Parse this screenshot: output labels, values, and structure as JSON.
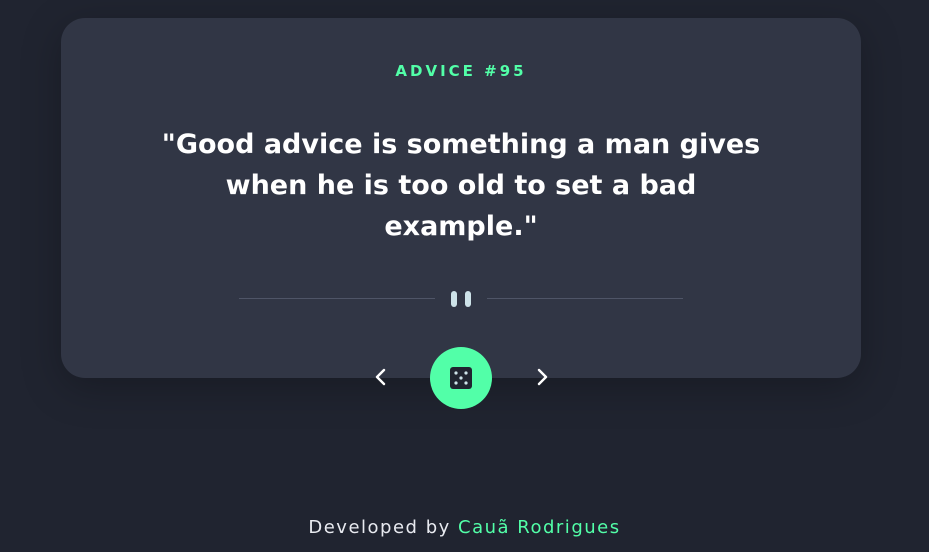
{
  "card": {
    "advice_label": "ADVICE #95",
    "quote": "\"Good advice is something a man gives when he is too old to set a bad example.\""
  },
  "controls": {
    "prev_icon": "chevron-left-icon",
    "next_icon": "chevron-right-icon",
    "dice_icon": "dice-icon"
  },
  "footer": {
    "prefix": "Developed by",
    "author": "Cauã Rodrigues"
  },
  "colors": {
    "background": "#202430",
    "card": "#313645",
    "accent": "#52ffa8",
    "text": "#ffffff",
    "divider": "#4f5567"
  }
}
